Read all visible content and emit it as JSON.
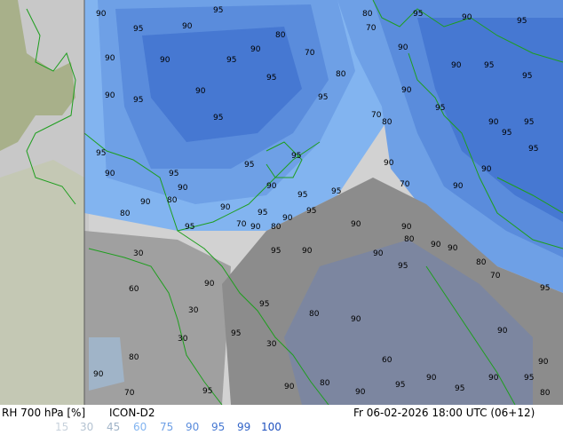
{
  "header": {
    "variable": "RH 700 hPa [%]",
    "model": "ICON-D2",
    "valid_time": "Fr 06-02-2026 18:00 UTC (06+12)"
  },
  "legend": {
    "values": [
      {
        "label": "15",
        "color": "#c8d2dc"
      },
      {
        "label": "30",
        "color": "#b4c3d2"
      },
      {
        "label": "45",
        "color": "#a0b4c8"
      },
      {
        "label": "60",
        "color": "#82b4f0"
      },
      {
        "label": "75",
        "color": "#6ea0e6"
      },
      {
        "label": "90",
        "color": "#5a8cdc"
      },
      {
        "label": "95",
        "color": "#4678d2"
      },
      {
        "label": "99",
        "color": "#3264c8"
      },
      {
        "label": "100",
        "color": "#1e50be"
      }
    ]
  },
  "map": {
    "contour_labels": [
      "90",
      "95",
      "90",
      "95",
      "90",
      "90",
      "95",
      "90",
      "95",
      "90",
      "95",
      "80",
      "70",
      "80",
      "95",
      "90",
      "95",
      "80",
      "70",
      "95",
      "90",
      "95",
      "90",
      "90",
      "95",
      "95",
      "90",
      "95",
      "80",
      "70",
      "90",
      "95",
      "95",
      "90",
      "90",
      "95",
      "90",
      "70",
      "95",
      "90",
      "95",
      "90",
      "95",
      "95",
      "90",
      "95",
      "80",
      "90",
      "95",
      "95",
      "90",
      "95",
      "90",
      "90",
      "80",
      "90",
      "80",
      "70",
      "80",
      "90",
      "95",
      "90",
      "95",
      "90",
      "95",
      "90",
      "80",
      "70",
      "90",
      "95",
      "90",
      "95",
      "80",
      "90",
      "90",
      "95",
      "30",
      "60",
      "60",
      "30",
      "30",
      "30",
      "80",
      "70",
      "90",
      "95",
      "90",
      "80",
      "90",
      "95",
      "90",
      "95",
      "90",
      "95",
      "90",
      "80"
    ]
  }
}
